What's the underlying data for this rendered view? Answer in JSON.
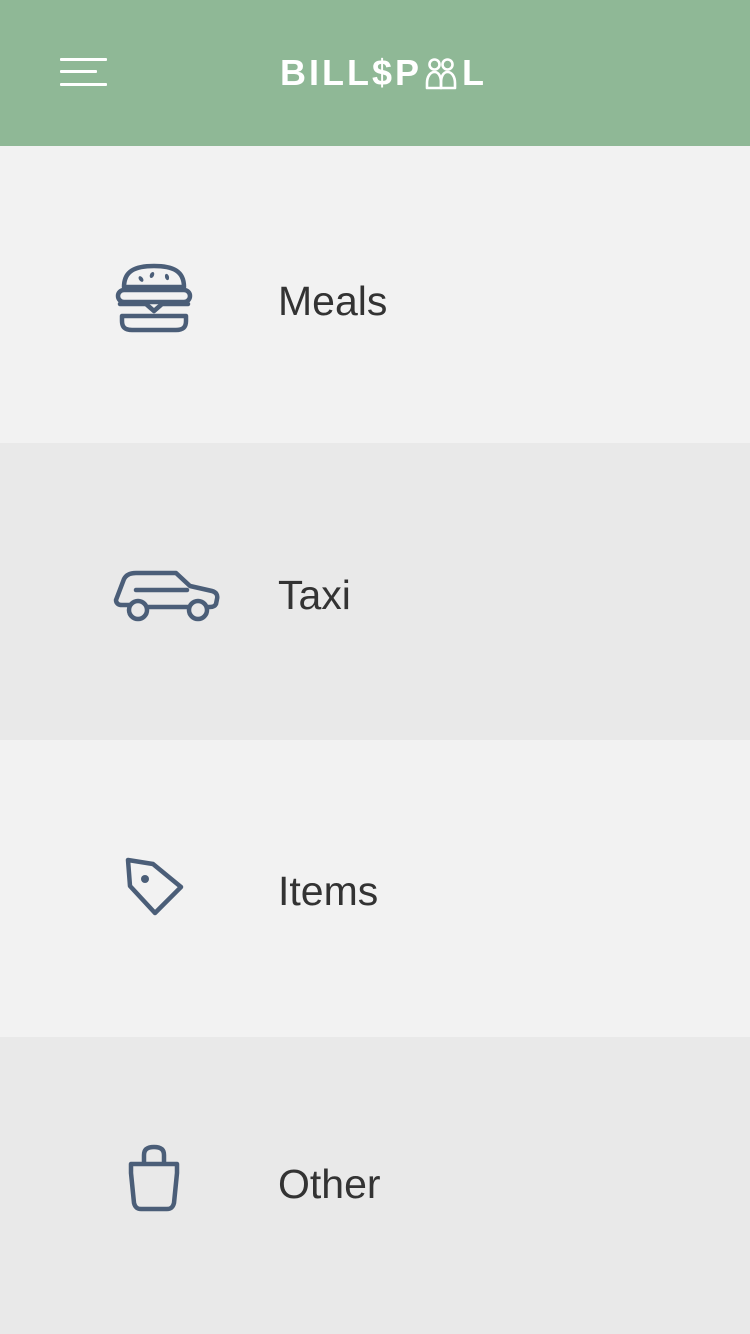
{
  "header": {
    "menu_icon": "hamburger-menu-icon",
    "logo_text_before": "BILL$P",
    "logo_text_after": "L",
    "logo_mark_icon": "people-pool-icon",
    "background_color": "#8fb896"
  },
  "categories": [
    {
      "label": "Meals",
      "icon": "burger-icon"
    },
    {
      "label": "Taxi",
      "icon": "car-icon"
    },
    {
      "label": "Items",
      "icon": "price-tag-icon"
    },
    {
      "label": "Other",
      "icon": "shopping-bag-icon"
    }
  ],
  "colors": {
    "icon_stroke": "#4b5e78",
    "row_light": "#f2f2f2",
    "row_dark": "#e9e9e9",
    "label_text": "#333333"
  }
}
